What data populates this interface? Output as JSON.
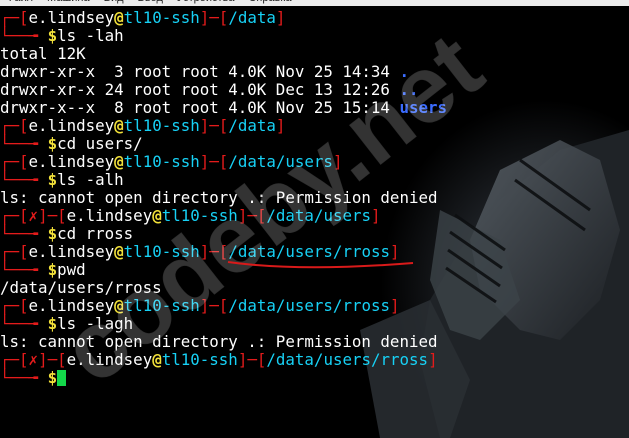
{
  "menubar": {
    "items": [
      "Файл",
      "Машина",
      "Вид",
      "Ввод",
      "Устройства",
      "Справка"
    ]
  },
  "terminal": {
    "lines": [
      {
        "t": "prompt",
        "fail": false,
        "user": "e.lindsey",
        "at": "@",
        "host": "tl10-ssh",
        "path": "/data"
      },
      {
        "t": "cmd",
        "text": "ls -lah"
      },
      {
        "t": "out",
        "text": "total 12K"
      },
      {
        "t": "dir",
        "text": "drwxr-xr-x  3 root root 4.0K Nov 25 14:34 ",
        "name": "."
      },
      {
        "t": "dir",
        "text": "drwxr-xr-x 24 root root 4.0K Dec 13 12:26 ",
        "name": ".."
      },
      {
        "t": "dir",
        "text": "drwxr-x--x  8 root root 4.0K Nov 25 15:14 ",
        "name": "users"
      },
      {
        "t": "prompt",
        "fail": false,
        "user": "e.lindsey",
        "at": "@",
        "host": "tl10-ssh",
        "path": "/data"
      },
      {
        "t": "cmd",
        "text": "cd users/"
      },
      {
        "t": "prompt",
        "fail": false,
        "user": "e.lindsey",
        "at": "@",
        "host": "tl10-ssh",
        "path": "/data/users"
      },
      {
        "t": "cmd",
        "text": "ls -alh"
      },
      {
        "t": "out",
        "text": "ls: cannot open directory .: Permission denied"
      },
      {
        "t": "prompt",
        "fail": true,
        "user": "e.lindsey",
        "at": "@",
        "host": "tl10-ssh",
        "path": "/data/users"
      },
      {
        "t": "cmd",
        "text": "cd rross"
      },
      {
        "t": "prompt",
        "fail": false,
        "user": "e.lindsey",
        "at": "@",
        "host": "tl10-ssh",
        "path": "/data/users/rross"
      },
      {
        "t": "cmd",
        "text": "pwd"
      },
      {
        "t": "out",
        "text": "/data/users/rross"
      },
      {
        "t": "prompt",
        "fail": false,
        "user": "e.lindsey",
        "at": "@",
        "host": "tl10-ssh",
        "path": "/data/users/rross"
      },
      {
        "t": "cmd",
        "text": "ls -lagh"
      },
      {
        "t": "out",
        "text": "ls: cannot open directory .: Permission denied"
      },
      {
        "t": "prompt",
        "fail": true,
        "user": "e.lindsey",
        "at": "@",
        "host": "tl10-ssh",
        "path": "/data/users/rross"
      },
      {
        "t": "cmd",
        "text": "",
        "cursor": true
      }
    ],
    "glyphs": {
      "prompt_top": "┌─",
      "prompt_bottom": "└──╼ ",
      "fail_mark": "✗",
      "dollar": "$",
      "dash": "─"
    }
  },
  "watermark": {
    "text": "codeby.net"
  },
  "colors": {
    "red": "#e31b1b",
    "cyan": "#17d1f5",
    "blue": "#3b6cff",
    "yellow": "#f2e13a",
    "cursor": "#13d84a"
  }
}
